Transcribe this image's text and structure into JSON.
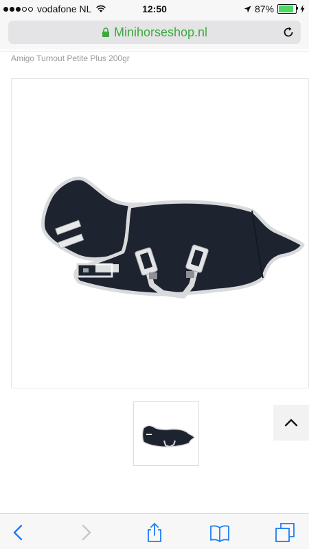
{
  "status_bar": {
    "carrier": "vodafone NL",
    "time": "12:50",
    "battery_percent": "87%",
    "battery_level": 0.87,
    "signal_bars_filled": 3,
    "signal_bars_total": 5
  },
  "browser": {
    "url": "Minihorseshop.nl",
    "url_color": "#3caa3c"
  },
  "product": {
    "title": "Amigo Turnout Petite Plus 200gr",
    "main_image": "horse-blanket-image",
    "thumbnail": "horse-blanket-thumbnail"
  },
  "icons": {
    "lock": "lock-icon",
    "reload": "reload-icon",
    "back": "back-chevron-icon",
    "forward": "forward-chevron-icon",
    "share": "share-icon",
    "bookmarks": "bookmarks-icon",
    "tabs": "tabs-icon",
    "scroll_top": "chevron-up-icon"
  },
  "colors": {
    "accent": "#1a7cf5",
    "disabled": "#c7c7cc",
    "blanket": "#1e2330",
    "trim": "#d8dadc"
  }
}
